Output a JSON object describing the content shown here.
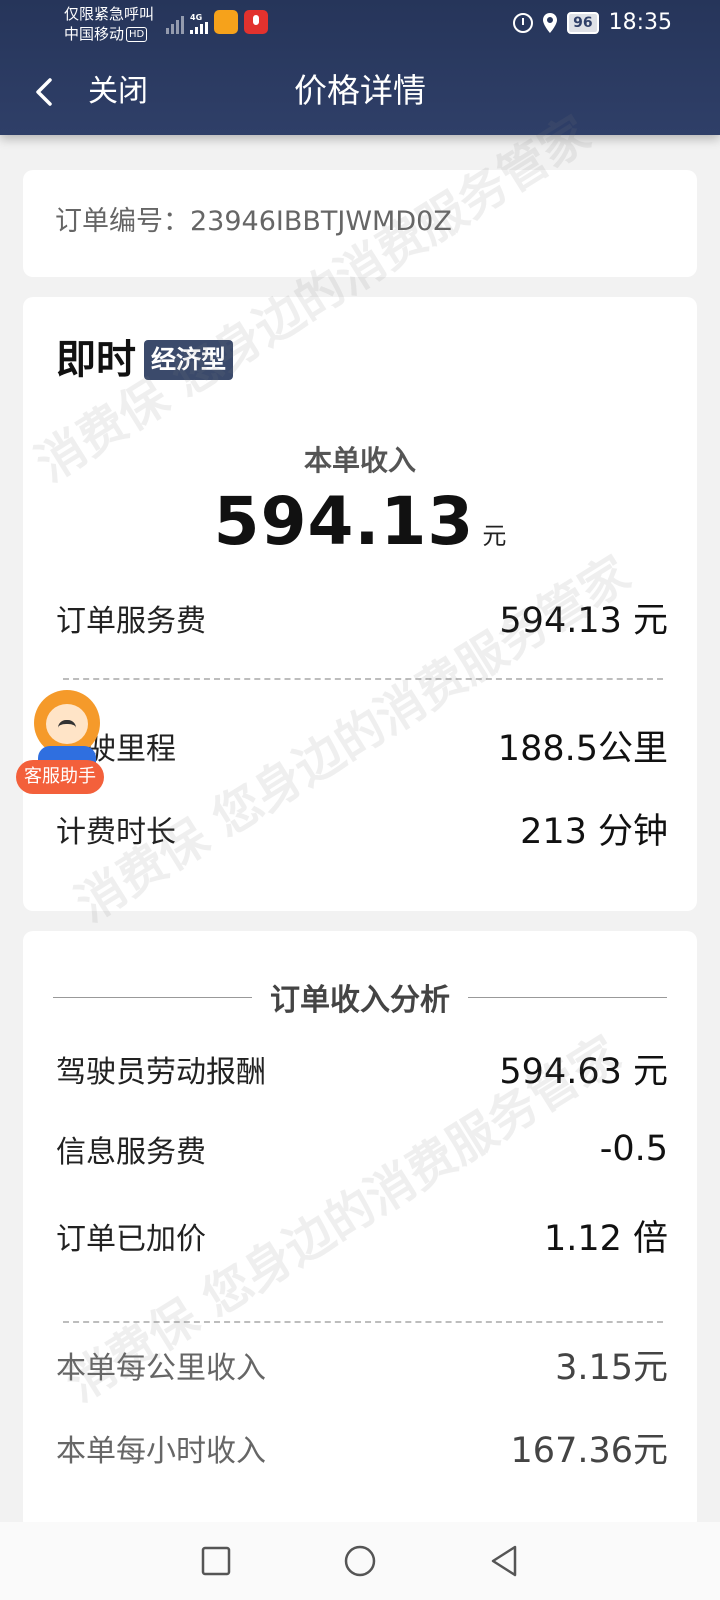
{
  "status_bar": {
    "carrier_line1": "仅限紧急呼叫",
    "carrier_line2": "中国移动",
    "hd_badge": "HD",
    "network": "4G",
    "battery": "96",
    "time": "18:35"
  },
  "nav": {
    "close_label": "关闭",
    "title": "价格详情"
  },
  "order": {
    "number_text": "订单编号：23946IBBTJWMD0Z"
  },
  "trip": {
    "type_main": "即时",
    "type_badge": "经济型",
    "income_label": "本单收入",
    "income_value": "594.13",
    "income_unit": "元",
    "rows": [
      {
        "label": "订单服务费",
        "value": "594.13 元"
      },
      {
        "label": "行驶里程",
        "value": "188.5公里"
      },
      {
        "label": "计费时长",
        "value": "213 分钟"
      }
    ]
  },
  "analysis": {
    "title": "订单收入分析",
    "rows": [
      {
        "label": "驾驶员劳动报酬",
        "value": "594.63 元"
      },
      {
        "label": "信息服务费",
        "value": "-0.5"
      },
      {
        "label": "订单已加价",
        "value": "1.12 倍"
      }
    ],
    "stats": [
      {
        "label": "本单每公里收入",
        "value": "3.15元"
      },
      {
        "label": "本单每小时收入",
        "value": "167.36元"
      }
    ]
  },
  "assistant": {
    "label": "客服助手"
  },
  "watermark": {
    "text": "消费保 您身边的消费服务管家"
  }
}
